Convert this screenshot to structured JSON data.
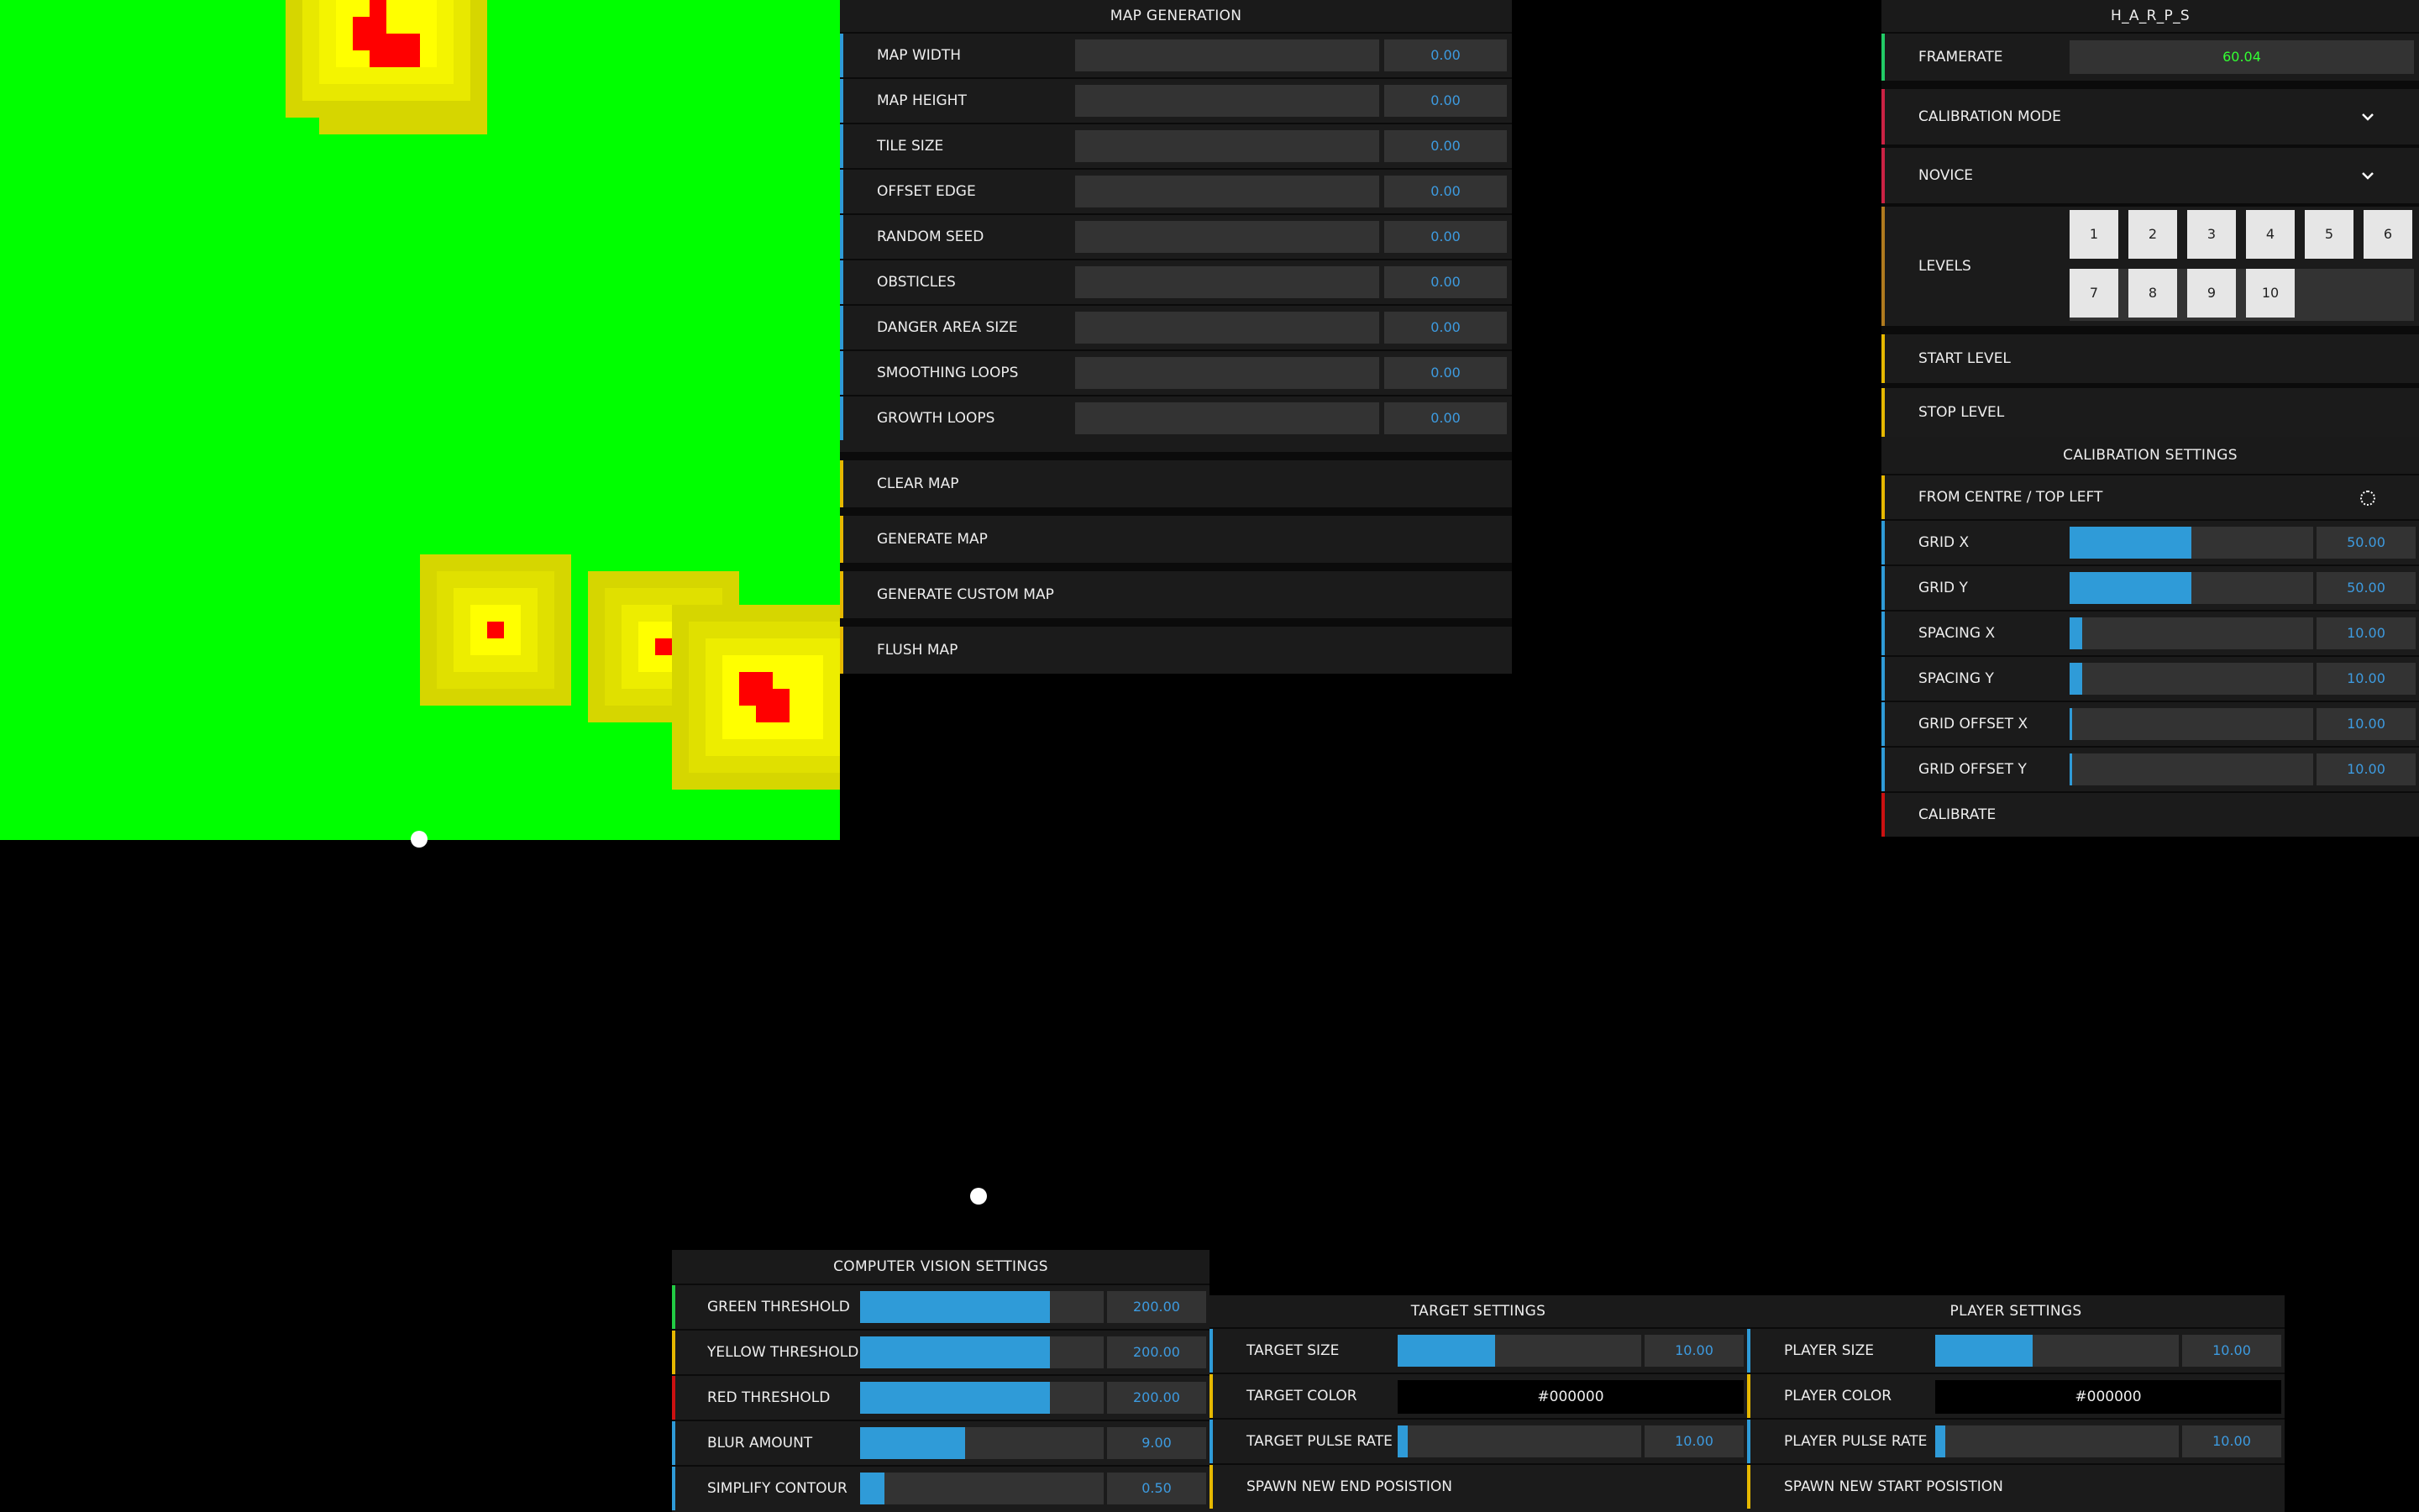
{
  "colors": {
    "green": "#00ff00",
    "yellow": "#ffff00",
    "red": "#ff0000",
    "accent_blue": "#2f9bd8",
    "framerate_green": "#33ff33"
  },
  "map_generation": {
    "title": "MAP GENERATION",
    "sliders": [
      {
        "label": "MAP WIDTH",
        "value": "0.00"
      },
      {
        "label": "MAP HEIGHT",
        "value": "0.00"
      },
      {
        "label": "TILE SIZE",
        "value": "0.00"
      },
      {
        "label": "OFFSET EDGE",
        "value": "0.00"
      },
      {
        "label": "RANDOM SEED",
        "value": "0.00"
      },
      {
        "label": "OBSTICLES",
        "value": "0.00"
      },
      {
        "label": "DANGER AREA SIZE",
        "value": "0.00"
      },
      {
        "label": "SMOOTHING LOOPS",
        "value": "0.00"
      },
      {
        "label": "GROWTH LOOPS",
        "value": "0.00"
      }
    ],
    "buttons": [
      "CLEAR MAP",
      "GENERATE MAP",
      "GENERATE CUSTOM MAP",
      "FLUSH MAP"
    ]
  },
  "harps": {
    "title": "H_A_R_P_S",
    "framerate_label": "FRAMERATE",
    "framerate_value": "60.04",
    "mode_dropdown": "CALIBRATION MODE",
    "difficulty_dropdown": "NOVICE",
    "levels_label": "LEVELS",
    "levels": [
      "1",
      "2",
      "3",
      "4",
      "5",
      "6",
      "7",
      "8",
      "9",
      "10"
    ],
    "start_level": "START LEVEL",
    "stop_level": "STOP LEVEL",
    "calibration_title": "CALIBRATION SETTINGS",
    "from_centre_toggle": "FROM CENTRE / TOP LEFT",
    "calibration_sliders": [
      {
        "label": "GRID X",
        "value": "50.00",
        "fill": 0.5
      },
      {
        "label": "GRID Y",
        "value": "50.00",
        "fill": 0.5
      },
      {
        "label": "SPACING X",
        "value": "10.00",
        "fill": 0.05
      },
      {
        "label": "SPACING Y",
        "value": "10.00",
        "fill": 0.05
      },
      {
        "label": "GRID OFFSET X",
        "value": "10.00",
        "fill": 0.01
      },
      {
        "label": "GRID OFFSET Y",
        "value": "10.00",
        "fill": 0.01
      }
    ],
    "calibrate_button": "CALIBRATE"
  },
  "computer_vision": {
    "title": "COMPUTER VISION SETTINGS",
    "sliders": [
      {
        "label": "GREEN THRESHOLD",
        "value": "200.00",
        "fill": 0.78
      },
      {
        "label": "YELLOW THRESHOLD",
        "value": "200.00",
        "fill": 0.78
      },
      {
        "label": "RED THRESHOLD",
        "value": "200.00",
        "fill": 0.78
      },
      {
        "label": "BLUR AMOUNT",
        "value": "9.00",
        "fill": 0.43
      },
      {
        "label": "SIMPLIFY CONTOUR",
        "value": "0.50",
        "fill": 0.1
      }
    ]
  },
  "target_settings": {
    "title": "TARGET SETTINGS",
    "size_label": "TARGET SIZE",
    "size_value": "10.00",
    "size_fill": 0.4,
    "color_label": "TARGET COLOR",
    "color_value": "#000000",
    "pulse_label": "TARGET PULSE RATE",
    "pulse_value": "10.00",
    "pulse_fill": 0.04,
    "spawn_button": "SPAWN NEW END POSISTION"
  },
  "player_settings": {
    "title": "PLAYER SETTINGS",
    "size_label": "PLAYER SIZE",
    "size_value": "10.00",
    "size_fill": 0.4,
    "color_label": "PLAYER COLOR",
    "color_value": "#000000",
    "pulse_label": "PLAYER PULSE RATE",
    "pulse_value": "10.00",
    "pulse_fill": 0.04,
    "spawn_button": "SPAWN NEW START POSISTION"
  }
}
